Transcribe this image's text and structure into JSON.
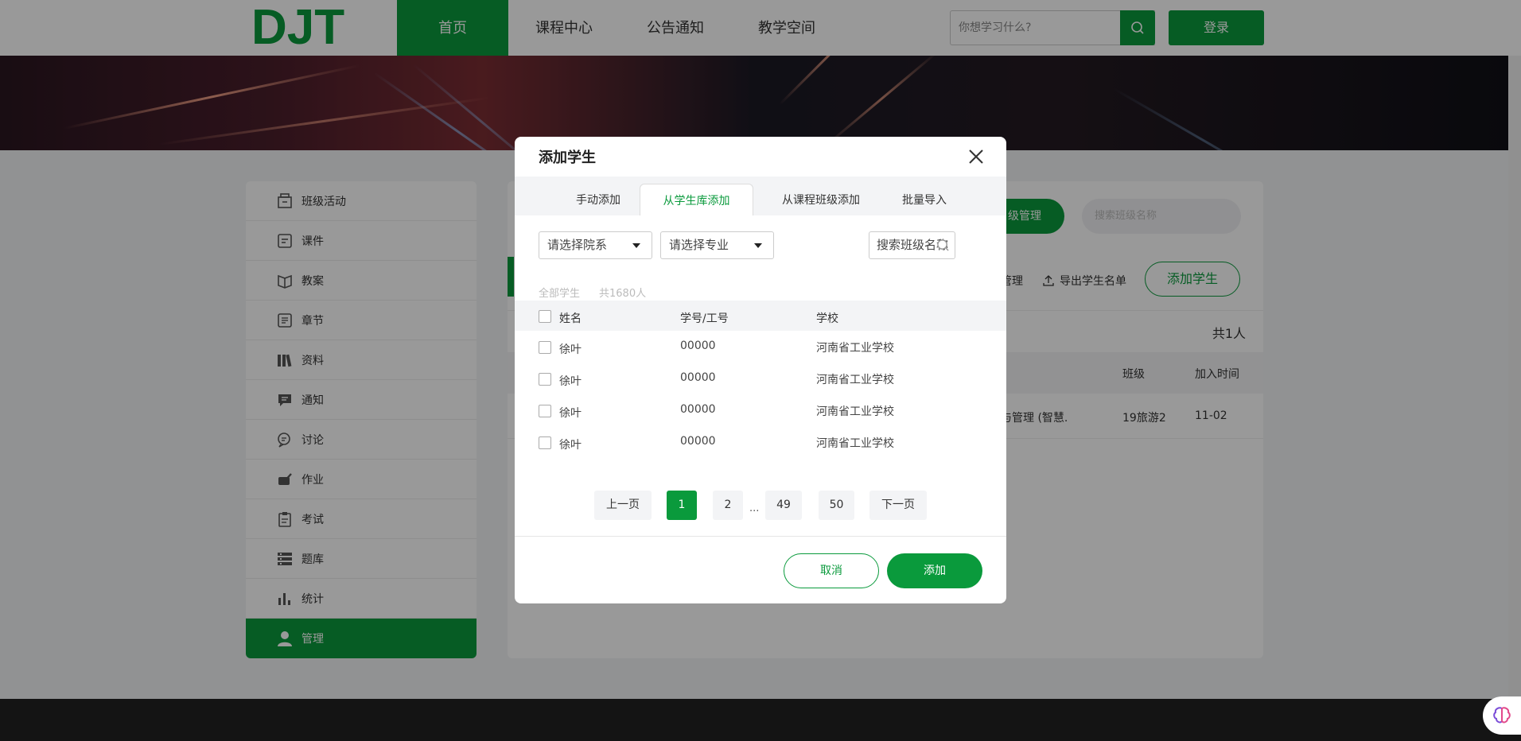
{
  "header": {
    "logo": "DJT",
    "nav": [
      "首页",
      "课程中心",
      "公告通知",
      "教学空间"
    ],
    "search_placeholder": "你想学习什么?",
    "login_label": "登录"
  },
  "sidebar": {
    "items": [
      {
        "label": "班级活动",
        "icon": "class-activity-icon"
      },
      {
        "label": "课件",
        "icon": "courseware-icon"
      },
      {
        "label": "教案",
        "icon": "lesson-plan-icon"
      },
      {
        "label": "章节",
        "icon": "chapter-icon"
      },
      {
        "label": "资料",
        "icon": "materials-icon"
      },
      {
        "label": "通知",
        "icon": "notice-icon"
      },
      {
        "label": "讨论",
        "icon": "discussion-icon"
      },
      {
        "label": "作业",
        "icon": "homework-icon"
      },
      {
        "label": "考试",
        "icon": "exam-icon"
      },
      {
        "label": "题库",
        "icon": "question-bank-icon"
      },
      {
        "label": "统计",
        "icon": "statistics-icon"
      },
      {
        "label": "管理",
        "icon": "user-icon"
      }
    ],
    "active_index": 11
  },
  "main": {
    "class_mgmt_label": "级管理",
    "class_search_placeholder": "搜索班级名称",
    "mgmt_link": "管理",
    "export_label": "导出学生名单",
    "add_student_label": "添加学生",
    "total": "共1人",
    "table": {
      "col_class": "班级",
      "col_time": "加入时间",
      "row": {
        "major": "与管理 (智慧.",
        "class": "19旅游2",
        "time": "11-02"
      }
    }
  },
  "modal": {
    "title": "添加学生",
    "tabs": [
      "手动添加",
      "从学生库添加",
      "从课程班级添加",
      "批量导入"
    ],
    "active_tab": 1,
    "dept_select": "请选择院系",
    "major_select": "请选择专业",
    "search_placeholder": "搜索班级名称",
    "all_students": "全部学生",
    "total_count": "共1680人",
    "columns": {
      "name": "姓名",
      "id": "学号/工号",
      "school": "学校"
    },
    "rows": [
      {
        "name": "徐叶",
        "id": "00000",
        "school": "河南省工业学校"
      },
      {
        "name": "徐叶",
        "id": "00000",
        "school": "河南省工业学校"
      },
      {
        "name": "徐叶",
        "id": "00000",
        "school": "河南省工业学校"
      },
      {
        "name": "徐叶",
        "id": "00000",
        "school": "河南省工业学校"
      }
    ],
    "pager": {
      "prev": "上一页",
      "pages": [
        "1",
        "2",
        "49",
        "50"
      ],
      "ellipsis": "...",
      "next": "下一页",
      "current": "1"
    },
    "cancel_label": "取消",
    "add_label": "添加"
  },
  "colors": {
    "brand": "#0a9a3c",
    "overlay": "rgba(0,0,0,0.4)"
  }
}
